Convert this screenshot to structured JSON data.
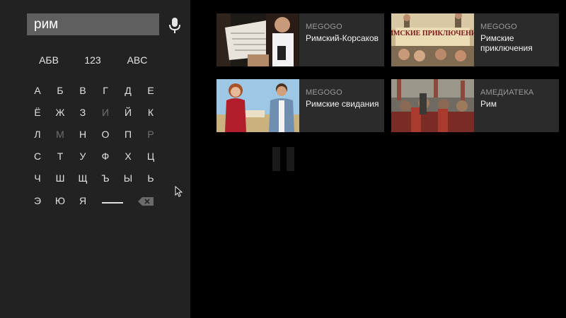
{
  "search": {
    "query": "рим"
  },
  "keyboard": {
    "modes": [
      "АБВ",
      "123",
      "ABC"
    ],
    "rows": [
      [
        "А",
        "Б",
        "В",
        "Г",
        "Д",
        "Е"
      ],
      [
        "Ё",
        "Ж",
        "З",
        "И",
        "Й",
        "К"
      ],
      [
        "Л",
        "М",
        "Н",
        "О",
        "П",
        "Р"
      ],
      [
        "С",
        "Т",
        "У",
        "Ф",
        "Х",
        "Ц"
      ],
      [
        "Ч",
        "Ш",
        "Щ",
        "Ъ",
        "Ы",
        "Ь"
      ],
      [
        "Э",
        "Ю",
        "Я"
      ]
    ],
    "dimmed": [
      "И",
      "М",
      "Р"
    ],
    "space_icon": "space-bar-icon",
    "backspace_icon": "backspace-icon"
  },
  "results": [
    {
      "provider": "MEGOGO",
      "title": "Римский-Корсаков"
    },
    {
      "provider": "MEGOGO",
      "title": "Римские приключения",
      "poster_text": "РИМСКИЕ ПРИКЛЮЧЕНИЯ"
    },
    {
      "provider": "MEGOGO",
      "title": "Римские свидания"
    },
    {
      "provider": "АМЕДИАТЕКА",
      "title": "Рим"
    }
  ],
  "icons": {
    "mic": "microphone-icon",
    "cursor": "mouse-cursor-icon",
    "pause": "pause-icon"
  },
  "colors": {
    "sidebar": "#222222",
    "search_field": "#5f5f5f",
    "card": "#2b2b2b",
    "background": "#000000"
  }
}
